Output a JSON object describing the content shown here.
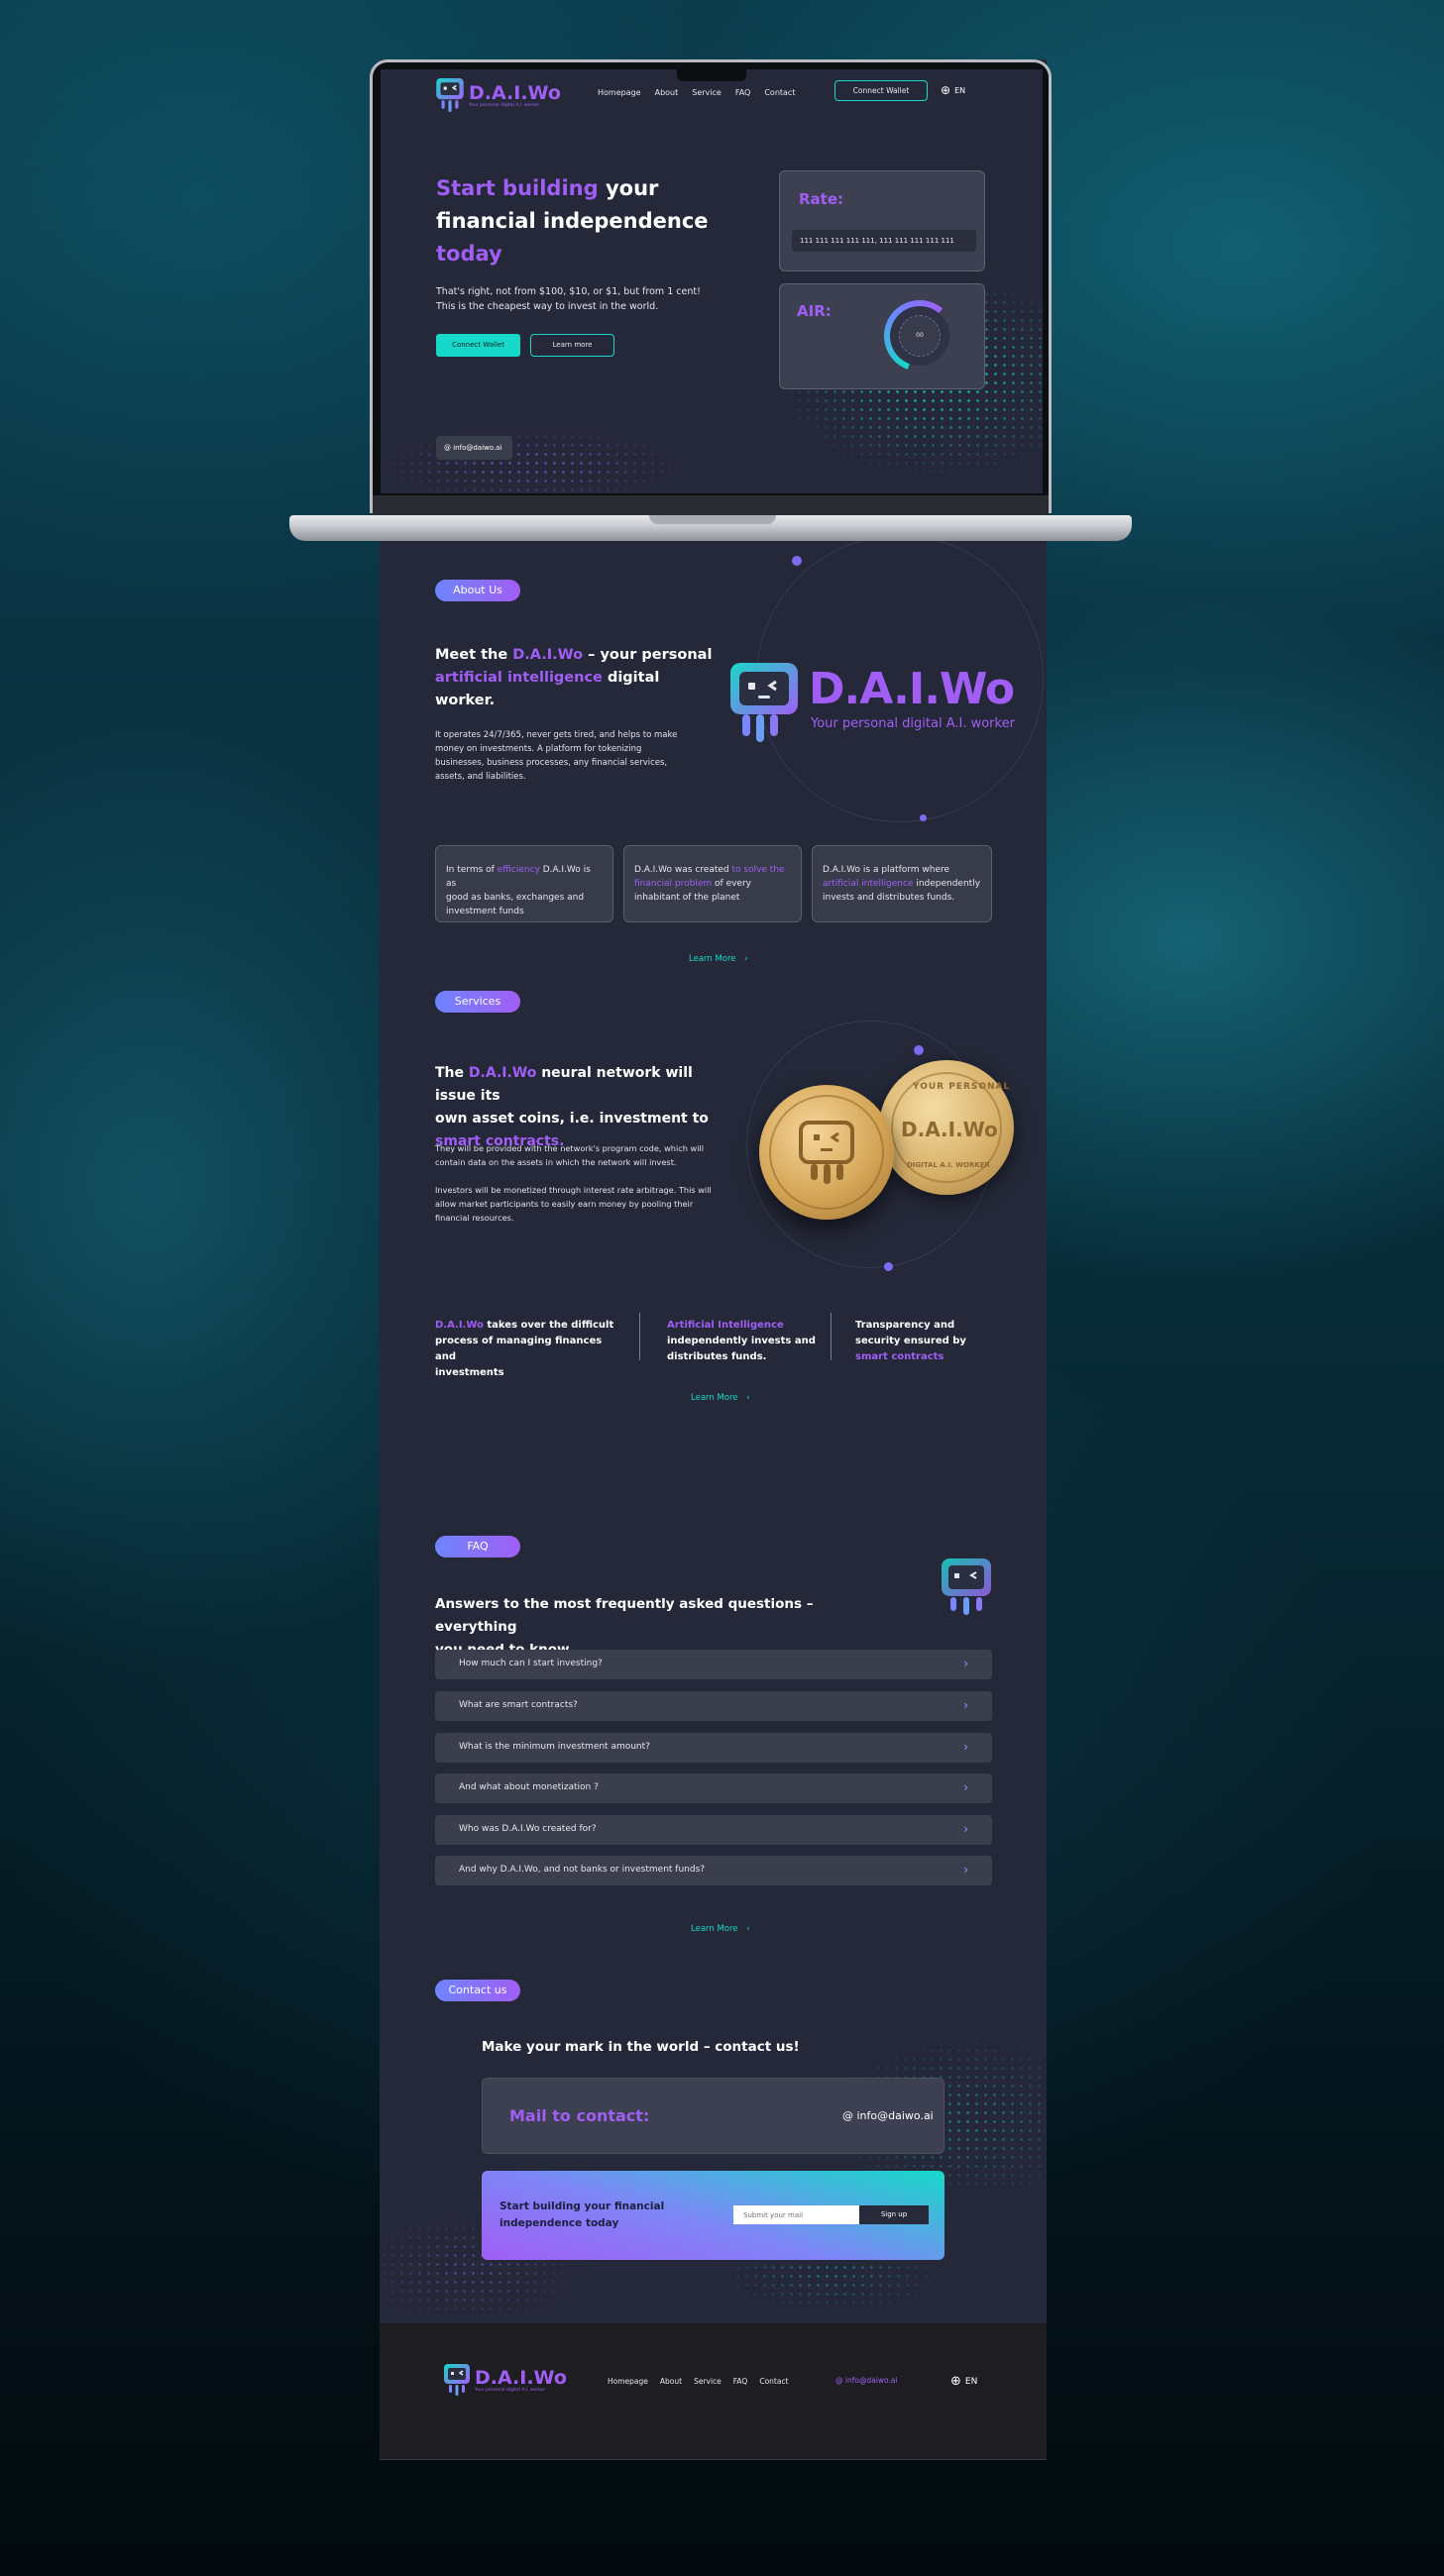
{
  "brand": {
    "name": "D.A.I.Wo",
    "tagline": "Your personal digital A.I. worker"
  },
  "nav": {
    "items": [
      "Homepage",
      "About",
      "Service",
      "FAQ",
      "Contact"
    ],
    "connect_wallet": "Connect Wallet",
    "lang": "EN"
  },
  "hero": {
    "title_part1": "Start building",
    "title_part2": " your",
    "title_line2": "financial independence",
    "title_line3": "today",
    "body_line1": "That's right, not from $100, $10, or $1, but from 1 cent!",
    "body_line2": "This is the cheapest way to invest in the world.",
    "btn_primary": "Connect Wallet",
    "btn_secondary": "Learn more",
    "email": "info@daiwo.ai",
    "rate_label": "Rate:",
    "rate_value": "111 111 111 111 111, 111 111 111 111 111",
    "air_label": "AIR:",
    "air_value": "00"
  },
  "about": {
    "pill": "About Us",
    "heading_a": "Meet the ",
    "heading_brand": "D.A.I.Wo",
    "heading_b": " –  your personal",
    "heading_c": "artificial intelligence",
    "heading_d": " digital worker.",
    "body_line1": "It operates 24/7/365, never gets tired, and helps to make",
    "body_line2": "money on investments. A platform for tokenizing",
    "body_line3": "businesses, business processes, any financial services,",
    "body_line4": "assets, and liabilities.",
    "logo_name": "D.A.I.Wo",
    "logo_tagline": "Your personal digital A.I. worker",
    "cards": [
      {
        "l1a": "In terms of ",
        "l1b": "efficiency",
        "l1c": " D.A.I.Wo is as",
        "l2": "good as banks, exchanges and",
        "l3": "investment funds"
      },
      {
        "l1a": "D.A.I.Wo was created ",
        "l1b": "to solve the",
        "l2b": "financial problem",
        "l2c": " of every",
        "l3": "inhabitant of the planet"
      },
      {
        "l1": "D.A.I.Wo is a platform where",
        "l2b": "artificial intelligence",
        "l2c": " independently",
        "l3": "invests and distributes funds."
      }
    ],
    "learn_more": "Learn More"
  },
  "services": {
    "pill": "Services",
    "h_a": "The ",
    "h_brand": "D.A.I.Wo",
    "h_b": " neural network will issue its",
    "h_line2": "own asset coins, i.e. investment to",
    "h_line3": " smart contracts.",
    "p1_l1": "They will be provided with the network's program code, which will",
    "p1_l2": "contain data on the assets in which the network will invest.",
    "p2_l1": "Investors will be monetized through interest rate arbitrage. This will",
    "p2_l2": "allow market participants to easily earn money by pooling their",
    "p2_l3": "financial resources.",
    "coin_text_top": "YOUR PERSONAL",
    "coin_text_mid": "D.A.I.Wo",
    "coin_text_bot": "DIGITAL A.I. WORKER",
    "f1_brand": "D.A.I.Wo",
    "f1_a": "  takes over the difficult",
    "f1_b": "process of managing finances and",
    "f1_c": "investments",
    "f2_a": "Artificial Intelligence",
    "f2_b": "independently invests and",
    "f2_c": "distributes funds.",
    "f3_a": "Transparency and",
    "f3_b": "security ensured by",
    "f3_c": " smart contracts",
    "learn_more": "Learn More"
  },
  "faq": {
    "pill": "FAQ",
    "heading_l1": "Answers to the most frequently asked questions – everything",
    "heading_l2": "you need to know",
    "questions": [
      "How much can I start investing?",
      "What are smart contracts?",
      "What is the minimum investment amount?",
      "And what about  monetization ?",
      "Who was D.A.I.Wo created for?",
      "And why D.A.I.Wo, and not banks or investment funds?"
    ],
    "learn_more": "Learn More"
  },
  "contact": {
    "pill": "Contact us",
    "heading": "Make your mark in the world – contact us!",
    "mail_label": "Mail to contact:",
    "email": "info@daiwo.ai",
    "cta_l1": "Start building your financial",
    "cta_l2": "independence today",
    "input_placeholder": "Submit your mail",
    "signup": "Sign up"
  },
  "footer": {
    "items": [
      "Homepage",
      "About",
      "Service",
      "FAQ",
      "Contact"
    ],
    "email": "info@daiwo.ai",
    "lang": "EN"
  },
  "colors": {
    "accent_purple": "#a15ef5",
    "accent_teal": "#17d9c9",
    "panel": "#242838",
    "footer": "#1e1e22"
  }
}
